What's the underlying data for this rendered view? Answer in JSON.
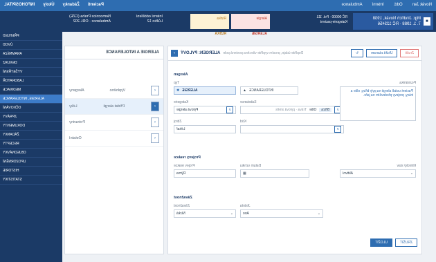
{
  "app_name": "INFOHOSPITAL",
  "topbar": {
    "left_items": [
      "Novák Jan",
      "Odd.",
      "Interní",
      "Ambulance"
    ],
    "right_items": [
      "Pacienti",
      "Žádanky",
      "Úkoly",
      "Nastavení"
    ]
  },
  "patient": {
    "name": "Kategorie-pacient",
    "info_line1": "Mgr. Jindřich Novák, 1938",
    "info_line2": "7. 1. 1988 · RČ 123456",
    "info_line3": "RČ 00000 · Pol. 111"
  },
  "alerts": [
    {
      "label": "Alergie",
      "value": "ALERGIE",
      "color": "#fbe3e3",
      "text_color": "#c0392b"
    },
    {
      "label": "Rizika",
      "value": "RIZIKA",
      "color": "#fdf2d4",
      "text_color": "#b7791f"
    }
  ],
  "header_info": {
    "clinic": "Nemocnice Praha (CZE)",
    "clinic_sub": "Ambulance · ORL 202",
    "dept": "Interní oddělení",
    "dept_sub": "Lůžko 12"
  },
  "sidebar": {
    "items": [
      {
        "label": "PŘEHLED",
        "active": false
      },
      {
        "label": "ÚVOD",
        "active": false
      },
      {
        "label": "ANAMNÉZA",
        "active": false
      },
      {
        "label": "DEKURZ",
        "active": false
      },
      {
        "label": "VYŠETŘENÍ",
        "active": false
      },
      {
        "label": "LABORATOŘ",
        "active": false
      },
      {
        "label": "MEDIKACE",
        "active": false
      },
      {
        "label": "ALERGIE, INTOLERANCE",
        "active": true
      },
      {
        "label": "OČKOVÁNÍ",
        "active": false
      },
      {
        "label": "ZPRÁVY",
        "active": false
      },
      {
        "label": "DOKUMENTY",
        "active": false
      },
      {
        "label": "ŽÁDANKY",
        "active": false
      },
      {
        "label": "RECEPTY",
        "active": false
      },
      {
        "label": "OBJEDNÁVKY",
        "active": false
      },
      {
        "label": "UPOZORNĚNÍ",
        "active": false
      },
      {
        "label": "HISTORIE",
        "active": false
      },
      {
        "label": "STATISTIKY",
        "active": false
      }
    ]
  },
  "tree": {
    "title": "ALERGIE A INTOLERANCE",
    "rows": [
      {
        "label": "Alergeny",
        "value": "Vyplněno",
        "active": false
      },
      {
        "label": "Léky",
        "value": "Přidat alergii",
        "active": true
      },
      {
        "label": "Potraviny",
        "value": "",
        "active": false
      },
      {
        "label": "Ostatní",
        "value": "",
        "active": false
      }
    ]
  },
  "form": {
    "title": "ALERGEN: PYLOVÝ",
    "subtitle": "Doplňte údaje, prosím vyplňte všechna povinná pole",
    "buttons": {
      "cancel": "Zrušit",
      "save": "Uložit záznam",
      "refresh": "↻"
    },
    "sections": {
      "alergen": "Alergen",
      "reakce": "Projevy reakce",
      "zavaznost": "Závažnost",
      "poznamka_label": "Poznámka"
    },
    "fields": {
      "typ_label": "Typ",
      "typ_value": "ALERGIE",
      "intolerance_value": "INTOLERANCE",
      "kategorie_label": "Kategorie",
      "kategorie_value": "Pylová alergie",
      "substance_label": "Substance",
      "substance_value": "Bříza",
      "substance_opt": "Olše",
      "substance_opt2": "Tráva · pylová směs",
      "source_label": "Zdroj",
      "source_value": "Lékař",
      "kod_label": "Kód",
      "kod_value": "",
      "note_text": "Pacient uvádí alergii na pyly břízy, olše a trávy, projevy především na jaře.",
      "reakce_label": "Projev reakce",
      "reakce_value": "Rýma",
      "datum_label": "Datum vzniku",
      "datum_value": "",
      "klin_label": "Klinický stav",
      "klin_value": "Aktivní",
      "zavaz_label": "Závažnost",
      "zavaz_value": "Nízká",
      "jistota_label": "Jistota",
      "jistota_value": "Ano"
    },
    "footer": {
      "cancel": "ZRUŠIT",
      "save": "ULOŽIT"
    }
  }
}
